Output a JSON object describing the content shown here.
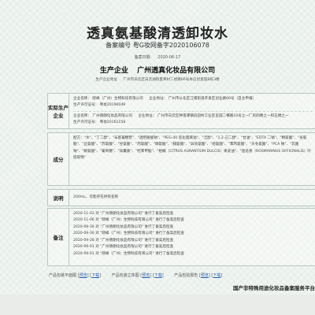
{
  "title": "透真氨基酸清透卸妆水",
  "reg_no": "备案编号  粤G妆网备字2020106078",
  "date": {
    "label": "备案日期",
    "value": "2020-06-17"
  },
  "company_header": {
    "label": "生产企业",
    "name": "广州透真化妆品有限公司"
  },
  "company_address": {
    "label": "生产企业地址",
    "value": "广州市白云区白云湖街夏茅村二经路66号本信创意园B栋3楼"
  },
  "sections": {
    "actual_producer": {
      "label": "实际生产企业",
      "rows": [
        {
          "a": "企业名称：  晓峰（广州）生物科技有限公司",
          "b": "企业地址：  广州市从化区江埔街道开发区创业路66号（自主申报）",
          "c": "生产许可证号：  粤妆20190049"
        },
        {
          "a": "企业名称：  广州德朗化妆品有限公司",
          "b": "企业地址：  广州市白云区钟落潭镇良田村工业区良田二横路10号之一厂房四楼之一和五楼之一",
          "c": "生产许可证号：  粤妆20161158"
        }
      ]
    },
    "ingredients": {
      "label": "成分",
      "text": "配方：\"水\"、\"丁二醇\"、\"辛基葡糖苷\"、\"透明质酸钠\"、\"PEG-40 氢化蓖麻油\"、\"泛醇\"、\"1,2-己二醇\"、\"甘油\"、\"EDTA 二钠\"、\"精氨酸\"、\"谷氨酸\"、\"丝氨酸\"、\"苏氨酸\"、\"甘氨酸\"、\"丙氨酸\"、\"缬氨酸\"、\"脯氨酸\"、\"异亮氨酸\"、\"组氨酸\"、\"苯丙氨酸\"、\"天冬氨酸\"、\"PCA 钠\"、\"乳酸钠\"、\"赖氨酸\"、\"葡萄糖\"、\"尿囊素\"、\"羟苯甲酯\"、\"柑橘（CITRUS AURANTIUM DULCIS）果皮油\"、\"迷迭香（ROSMARINUS OFFICINALIS）叶提取物\""
    },
    "notes": {
      "label": "说明",
      "text": "200mL，可能存在供货名称"
    },
    "remarks": {
      "label": "备注",
      "items": [
        "2020-11-03 对 \"广州德朗化妆品有限公司\" 进行了备案后检查",
        "2020-11-06 对 \"晓峰（广州）生物科技有限公司\" 进行了备案后检查",
        "2020-09-30 对 \"广州德朗化妆品有限公司\" 进行了备案后检查",
        "2020-09-30 对 \"晓峰（广州）生物科技有限公司\" 进行了备案后检查",
        "2020-09-28 对 \"广州德朗化妆品有限公司\" 进行了备案后检查",
        "2020-09-01 对 \"广州德朗化妆品有限公司\" 进行了备案后检查",
        "2020-09-01 对 \"晓峰（广州）生物科技有限公司\" 进行了备案后检查"
      ]
    }
  },
  "footer": {
    "items": [
      {
        "label": "产品包装平面图",
        "preview": "预览",
        "download": "下载"
      },
      {
        "label": "产品包装立体图",
        "preview": "预览",
        "download": "下载"
      },
      {
        "label": "产品检验报告",
        "preview": "预览",
        "download": "下载"
      }
    ],
    "banner": "国产非特殊用途化妆品备案服务平台"
  }
}
